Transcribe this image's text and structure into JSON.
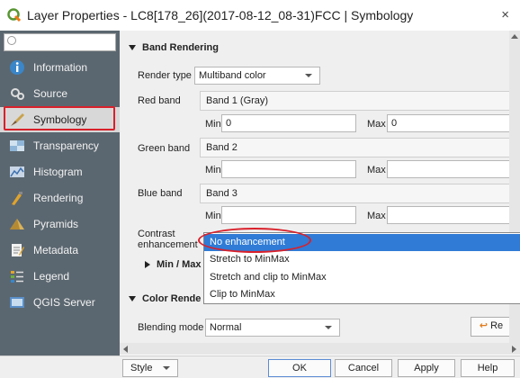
{
  "window": {
    "title": "Layer Properties - LC8[178_26](2017-08-12_08-31)FCC | Symbology",
    "close_glyph": "×"
  },
  "sidebar": {
    "search_placeholder": "",
    "items": [
      {
        "label": "Information",
        "icon": "information-icon"
      },
      {
        "label": "Source",
        "icon": "source-icon"
      },
      {
        "label": "Symbology",
        "icon": "symbology-icon",
        "active": true
      },
      {
        "label": "Transparency",
        "icon": "transparency-icon"
      },
      {
        "label": "Histogram",
        "icon": "histogram-icon"
      },
      {
        "label": "Rendering",
        "icon": "rendering-icon"
      },
      {
        "label": "Pyramids",
        "icon": "pyramids-icon"
      },
      {
        "label": "Metadata",
        "icon": "metadata-icon"
      },
      {
        "label": "Legend",
        "icon": "legend-icon"
      },
      {
        "label": "QGIS Server",
        "icon": "qgis-server-icon"
      }
    ]
  },
  "band_rendering": {
    "header": "Band Rendering",
    "render_type_label": "Render type",
    "render_type_value": "Multiband color",
    "red_band_label": "Red band",
    "red_band_value": "Band 1 (Gray)",
    "red_min_label": "Min",
    "red_min_value": "0",
    "red_max_label": "Max",
    "red_max_value": "0",
    "green_band_label": "Green band",
    "green_band_value": "Band 2",
    "green_min_label": "Min",
    "green_max_label": "Max",
    "blue_band_label": "Blue band",
    "blue_band_value": "Band 3",
    "blue_min_label": "Min",
    "blue_max_label": "Max",
    "contrast_label_1": "Contrast",
    "contrast_label_2": "enhancement",
    "minmax_header": "Min / Max"
  },
  "contrast_dropdown": {
    "options": [
      "No enhancement",
      "Stretch to MinMax",
      "Stretch and clip to MinMax",
      "Clip to MinMax"
    ],
    "selected": "No enhancement"
  },
  "color_rendering": {
    "header": "Color Rende",
    "blending_label": "Blending mode",
    "blending_value": "Normal",
    "reset_button": "Re"
  },
  "buttons": {
    "style": "Style",
    "ok": "OK",
    "cancel": "Cancel",
    "apply": "Apply",
    "help": "Help"
  },
  "colors": {
    "sidebar_bg": "#5b6770",
    "highlight_red": "#d9202a",
    "selection_blue": "#2f7bd6"
  }
}
